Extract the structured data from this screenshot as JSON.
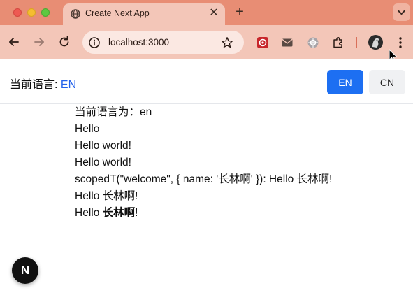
{
  "browser": {
    "tab_title": "Create Next App",
    "tab_close_glyph": "✕",
    "new_tab_glyph": "+",
    "url": "localhost:3000",
    "icons": [
      "globe-icon",
      "back-arrow-icon",
      "forward-arrow-icon",
      "reload-icon",
      "site-info-icon",
      "bookmark-star-icon",
      "extension-red-icon",
      "mail-icon",
      "extension-gear-icon",
      "puzzle-icon",
      "profile-avatar-icon",
      "kebab-menu-icon",
      "chevron-down-icon"
    ]
  },
  "header": {
    "language_label": "当前语言: ",
    "language_code": "EN",
    "buttons": {
      "en": "EN",
      "cn": "CN"
    }
  },
  "content": {
    "current_language": "当前语言为：en",
    "hello": "Hello",
    "hello_world_1": "Hello world!",
    "hello_world_2": "Hello world!",
    "scoped": "scopedT(\"welcome\", { name: '长林啊' }): Hello 长林啊!",
    "hello_name_prefix": "Hello ",
    "hello_name": "长林啊!",
    "hello_bold_prefix": "Hello ",
    "hello_bold_name": "长林啊",
    "hello_bold_suffix": "!"
  },
  "next_badge": {
    "label": "N"
  },
  "colors": {
    "tabstrip": "#e88d74",
    "toolbar": "#f3c6b8",
    "accent_blue": "#1d6ff2",
    "link_blue": "#2563eb"
  }
}
